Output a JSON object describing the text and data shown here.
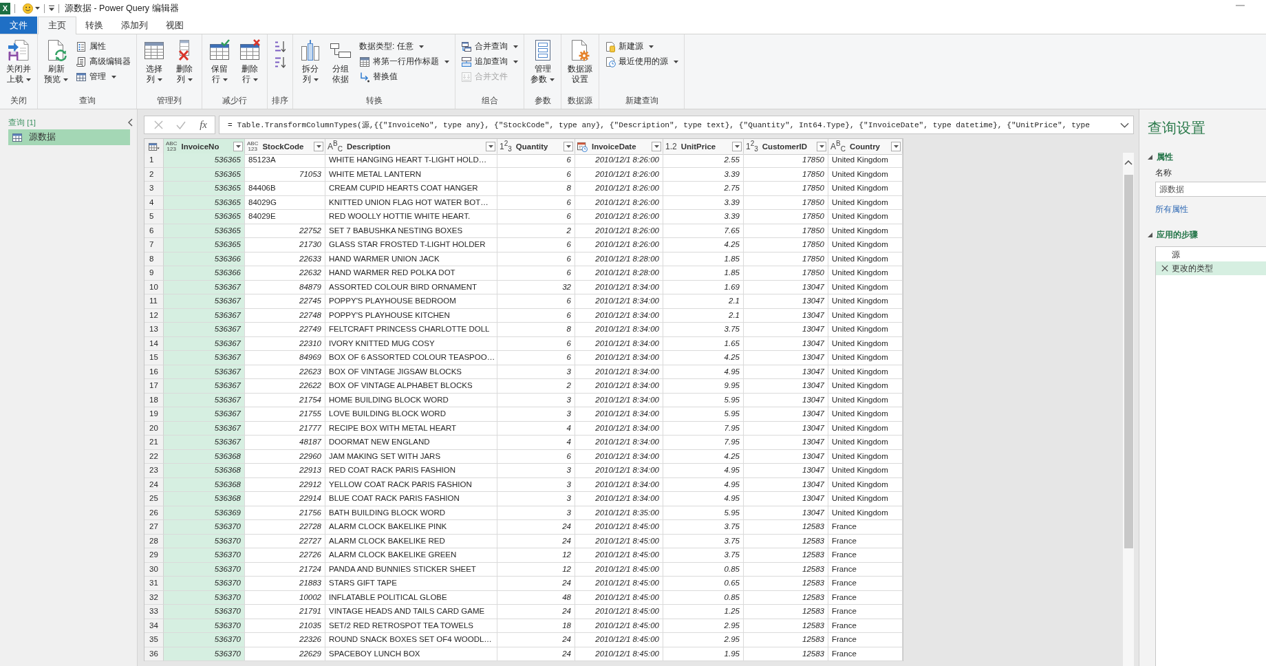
{
  "title_bar": {
    "app_badge": "X",
    "title": "源数据 - Power Query 编辑器"
  },
  "tabs": [
    {
      "label": "文件",
      "kind": "file",
      "selected": false
    },
    {
      "label": "主页",
      "kind": "tab",
      "selected": true
    },
    {
      "label": "转换",
      "kind": "tab",
      "selected": false
    },
    {
      "label": "添加列",
      "kind": "tab",
      "selected": false
    },
    {
      "label": "视图",
      "kind": "tab",
      "selected": false
    }
  ],
  "ribbon": {
    "groups": [
      {
        "label": "关闭",
        "buttons": [
          {
            "kind": "large",
            "lines": [
              "关闭并",
              "上载"
            ],
            "dropdown": true,
            "disabled": false
          }
        ]
      },
      {
        "label": "查询",
        "buttons": [
          {
            "kind": "large",
            "lines": [
              "刷新",
              "预览"
            ],
            "dropdown": true,
            "disabled": false
          },
          {
            "kind": "small",
            "lines": [
              "属性"
            ],
            "dropdown": false,
            "disabled": false
          },
          {
            "kind": "small",
            "lines": [
              "高级编辑器"
            ],
            "dropdown": false,
            "disabled": false
          },
          {
            "kind": "small",
            "lines": [
              "管理"
            ],
            "dropdown": true,
            "disabled": false
          }
        ]
      },
      {
        "label": "管理列",
        "buttons": [
          {
            "kind": "large",
            "lines": [
              "选择",
              "列"
            ],
            "dropdown": true,
            "disabled": false
          },
          {
            "kind": "large",
            "lines": [
              "删除",
              "列"
            ],
            "dropdown": true,
            "disabled": false
          }
        ]
      },
      {
        "label": "减少行",
        "buttons": [
          {
            "kind": "large",
            "lines": [
              "保留",
              "行"
            ],
            "dropdown": true,
            "disabled": false
          },
          {
            "kind": "large",
            "lines": [
              "删除",
              "行"
            ],
            "dropdown": true,
            "disabled": false
          }
        ]
      },
      {
        "label": "排序",
        "buttons": [
          {
            "kind": "icon",
            "dropdown": false,
            "disabled": false
          },
          {
            "kind": "icon",
            "dropdown": false,
            "disabled": false
          }
        ]
      },
      {
        "label": "转换",
        "buttons": [
          {
            "kind": "large",
            "lines": [
              "拆分",
              "列"
            ],
            "dropdown": true,
            "disabled": false
          },
          {
            "kind": "large",
            "lines": [
              "分组",
              "依据"
            ],
            "dropdown": false,
            "disabled": false
          },
          {
            "kind": "small",
            "lines": [
              "数据类型: 任意"
            ],
            "dropdown": true,
            "disabled": false
          },
          {
            "kind": "small",
            "lines": [
              "将第一行用作标题"
            ],
            "dropdown": true,
            "disabled": false
          },
          {
            "kind": "small",
            "lines": [
              "替换值"
            ],
            "dropdown": false,
            "disabled": false
          }
        ]
      },
      {
        "label": "组合",
        "buttons": [
          {
            "kind": "small",
            "lines": [
              "合并查询"
            ],
            "dropdown": true,
            "disabled": false
          },
          {
            "kind": "small",
            "lines": [
              "追加查询"
            ],
            "dropdown": true,
            "disabled": false
          },
          {
            "kind": "small",
            "lines": [
              "合并文件"
            ],
            "dropdown": false,
            "disabled": true
          }
        ]
      },
      {
        "label": "参数",
        "buttons": [
          {
            "kind": "large",
            "lines": [
              "管理",
              "参数"
            ],
            "dropdown": true,
            "disabled": false
          }
        ]
      },
      {
        "label": "数据源",
        "buttons": [
          {
            "kind": "large",
            "lines": [
              "数据源",
              "设置"
            ],
            "dropdown": false,
            "disabled": false
          }
        ]
      },
      {
        "label": "新建查询",
        "buttons": [
          {
            "kind": "small",
            "lines": [
              "新建源"
            ],
            "dropdown": true,
            "disabled": false
          },
          {
            "kind": "small",
            "lines": [
              "最近使用的源"
            ],
            "dropdown": true,
            "disabled": false
          }
        ]
      }
    ]
  },
  "queries_panel": {
    "header": "查询 [1]",
    "items": [
      {
        "label": "源数据",
        "selected": true
      }
    ]
  },
  "formula_bar": {
    "function_label": "fx",
    "formula": "= Table.TransformColumnTypes(源,{{\"InvoiceNo\", type any}, {\"StockCode\", type any}, {\"Description\", type text}, {\"Quantity\", Int64.Type}, {\"InvoiceDate\", type datetime}, {\"UnitPrice\", type"
  },
  "table": {
    "columns": [
      {
        "name": "InvoiceNo",
        "kind": "any",
        "type_label": [
          "ABC",
          "123"
        ],
        "selected": true
      },
      {
        "name": "StockCode",
        "kind": "any",
        "type_label": [
          "ABC",
          "123"
        ],
        "selected": false
      },
      {
        "name": "Description",
        "kind": "text",
        "type_label": [
          "A$^{B}$$_{C}$"
        ],
        "selected": false
      },
      {
        "name": "Quantity",
        "kind": "whole",
        "type_label": [
          "1$^{2}$$_{3}$"
        ],
        "selected": false
      },
      {
        "name": "InvoiceDate",
        "kind": "datetime",
        "selected": false
      },
      {
        "name": "UnitPrice",
        "kind": "decimal",
        "type_label": [
          "1.2"
        ],
        "selected": false
      },
      {
        "name": "CustomerID",
        "kind": "whole",
        "type_label": [
          "1$^{2}$$_{3}$"
        ],
        "selected": false
      },
      {
        "name": "Country",
        "kind": "text",
        "type_label": [
          "A$^{B}$$_{C}$"
        ],
        "selected": false
      }
    ],
    "rows": [
      {
        "number": "1",
        "stock_code_is_text": true,
        "cells": [
          "536365",
          "85123A",
          "WHITE HANGING HEART T-LIGHT HOLD…",
          "6",
          "2010/12/1 8:26:00",
          "2.55",
          "17850",
          "United Kingdom"
        ]
      },
      {
        "number": "2",
        "stock_code_is_text": false,
        "cells": [
          "536365",
          "71053",
          "WHITE METAL LANTERN",
          "6",
          "2010/12/1 8:26:00",
          "3.39",
          "17850",
          "United Kingdom"
        ]
      },
      {
        "number": "3",
        "stock_code_is_text": true,
        "cells": [
          "536365",
          "84406B",
          "CREAM CUPID HEARTS COAT HANGER",
          "8",
          "2010/12/1 8:26:00",
          "2.75",
          "17850",
          "United Kingdom"
        ]
      },
      {
        "number": "4",
        "stock_code_is_text": true,
        "cells": [
          "536365",
          "84029G",
          "KNITTED UNION FLAG HOT WATER BOT…",
          "6",
          "2010/12/1 8:26:00",
          "3.39",
          "17850",
          "United Kingdom"
        ]
      },
      {
        "number": "5",
        "stock_code_is_text": true,
        "cells": [
          "536365",
          "84029E",
          "RED WOOLLY HOTTIE WHITE HEART.",
          "6",
          "2010/12/1 8:26:00",
          "3.39",
          "17850",
          "United Kingdom"
        ]
      },
      {
        "number": "6",
        "stock_code_is_text": false,
        "cells": [
          "536365",
          "22752",
          "SET 7 BABUSHKA NESTING BOXES",
          "2",
          "2010/12/1 8:26:00",
          "7.65",
          "17850",
          "United Kingdom"
        ]
      },
      {
        "number": "7",
        "stock_code_is_text": false,
        "cells": [
          "536365",
          "21730",
          "GLASS STAR FROSTED T-LIGHT HOLDER",
          "6",
          "2010/12/1 8:26:00",
          "4.25",
          "17850",
          "United Kingdom"
        ]
      },
      {
        "number": "8",
        "stock_code_is_text": false,
        "cells": [
          "536366",
          "22633",
          "HAND WARMER UNION JACK",
          "6",
          "2010/12/1 8:28:00",
          "1.85",
          "17850",
          "United Kingdom"
        ]
      },
      {
        "number": "9",
        "stock_code_is_text": false,
        "cells": [
          "536366",
          "22632",
          "HAND WARMER RED POLKA DOT",
          "6",
          "2010/12/1 8:28:00",
          "1.85",
          "17850",
          "United Kingdom"
        ]
      },
      {
        "number": "10",
        "stock_code_is_text": false,
        "cells": [
          "536367",
          "84879",
          "ASSORTED COLOUR BIRD ORNAMENT",
          "32",
          "2010/12/1 8:34:00",
          "1.69",
          "13047",
          "United Kingdom"
        ]
      },
      {
        "number": "11",
        "stock_code_is_text": false,
        "cells": [
          "536367",
          "22745",
          "POPPY'S PLAYHOUSE BEDROOM",
          "6",
          "2010/12/1 8:34:00",
          "2.1",
          "13047",
          "United Kingdom"
        ]
      },
      {
        "number": "12",
        "stock_code_is_text": false,
        "cells": [
          "536367",
          "22748",
          "POPPY'S PLAYHOUSE KITCHEN",
          "6",
          "2010/12/1 8:34:00",
          "2.1",
          "13047",
          "United Kingdom"
        ]
      },
      {
        "number": "13",
        "stock_code_is_text": false,
        "cells": [
          "536367",
          "22749",
          "FELTCRAFT PRINCESS CHARLOTTE DOLL",
          "8",
          "2010/12/1 8:34:00",
          "3.75",
          "13047",
          "United Kingdom"
        ]
      },
      {
        "number": "14",
        "stock_code_is_text": false,
        "cells": [
          "536367",
          "22310",
          "IVORY KNITTED MUG COSY",
          "6",
          "2010/12/1 8:34:00",
          "1.65",
          "13047",
          "United Kingdom"
        ]
      },
      {
        "number": "15",
        "stock_code_is_text": false,
        "cells": [
          "536367",
          "84969",
          "BOX OF 6 ASSORTED COLOUR TEASPOO…",
          "6",
          "2010/12/1 8:34:00",
          "4.25",
          "13047",
          "United Kingdom"
        ]
      },
      {
        "number": "16",
        "stock_code_is_text": false,
        "cells": [
          "536367",
          "22623",
          "BOX OF VINTAGE JIGSAW BLOCKS",
          "3",
          "2010/12/1 8:34:00",
          "4.95",
          "13047",
          "United Kingdom"
        ]
      },
      {
        "number": "17",
        "stock_code_is_text": false,
        "cells": [
          "536367",
          "22622",
          "BOX OF VINTAGE ALPHABET BLOCKS",
          "2",
          "2010/12/1 8:34:00",
          "9.95",
          "13047",
          "United Kingdom"
        ]
      },
      {
        "number": "18",
        "stock_code_is_text": false,
        "cells": [
          "536367",
          "21754",
          "HOME BUILDING BLOCK WORD",
          "3",
          "2010/12/1 8:34:00",
          "5.95",
          "13047",
          "United Kingdom"
        ]
      },
      {
        "number": "19",
        "stock_code_is_text": false,
        "cells": [
          "536367",
          "21755",
          "LOVE BUILDING BLOCK WORD",
          "3",
          "2010/12/1 8:34:00",
          "5.95",
          "13047",
          "United Kingdom"
        ]
      },
      {
        "number": "20",
        "stock_code_is_text": false,
        "cells": [
          "536367",
          "21777",
          "RECIPE BOX WITH METAL HEART",
          "4",
          "2010/12/1 8:34:00",
          "7.95",
          "13047",
          "United Kingdom"
        ]
      },
      {
        "number": "21",
        "stock_code_is_text": false,
        "cells": [
          "536367",
          "48187",
          "DOORMAT NEW ENGLAND",
          "4",
          "2010/12/1 8:34:00",
          "7.95",
          "13047",
          "United Kingdom"
        ]
      },
      {
        "number": "22",
        "stock_code_is_text": false,
        "cells": [
          "536368",
          "22960",
          "JAM MAKING SET WITH JARS",
          "6",
          "2010/12/1 8:34:00",
          "4.25",
          "13047",
          "United Kingdom"
        ]
      },
      {
        "number": "23",
        "stock_code_is_text": false,
        "cells": [
          "536368",
          "22913",
          "RED COAT RACK PARIS FASHION",
          "3",
          "2010/12/1 8:34:00",
          "4.95",
          "13047",
          "United Kingdom"
        ]
      },
      {
        "number": "24",
        "stock_code_is_text": false,
        "cells": [
          "536368",
          "22912",
          "YELLOW COAT RACK PARIS FASHION",
          "3",
          "2010/12/1 8:34:00",
          "4.95",
          "13047",
          "United Kingdom"
        ]
      },
      {
        "number": "25",
        "stock_code_is_text": false,
        "cells": [
          "536368",
          "22914",
          "BLUE COAT RACK PARIS FASHION",
          "3",
          "2010/12/1 8:34:00",
          "4.95",
          "13047",
          "United Kingdom"
        ]
      },
      {
        "number": "26",
        "stock_code_is_text": false,
        "cells": [
          "536369",
          "21756",
          "BATH BUILDING BLOCK WORD",
          "3",
          "2010/12/1 8:35:00",
          "5.95",
          "13047",
          "United Kingdom"
        ]
      },
      {
        "number": "27",
        "stock_code_is_text": false,
        "cells": [
          "536370",
          "22728",
          "ALARM CLOCK BAKELIKE PINK",
          "24",
          "2010/12/1 8:45:00",
          "3.75",
          "12583",
          "France"
        ]
      },
      {
        "number": "28",
        "stock_code_is_text": false,
        "cells": [
          "536370",
          "22727",
          "ALARM CLOCK BAKELIKE RED",
          "24",
          "2010/12/1 8:45:00",
          "3.75",
          "12583",
          "France"
        ]
      },
      {
        "number": "29",
        "stock_code_is_text": false,
        "cells": [
          "536370",
          "22726",
          "ALARM CLOCK BAKELIKE GREEN",
          "12",
          "2010/12/1 8:45:00",
          "3.75",
          "12583",
          "France"
        ]
      },
      {
        "number": "30",
        "stock_code_is_text": false,
        "cells": [
          "536370",
          "21724",
          "PANDA AND BUNNIES STICKER SHEET",
          "12",
          "2010/12/1 8:45:00",
          "0.85",
          "12583",
          "France"
        ]
      },
      {
        "number": "31",
        "stock_code_is_text": false,
        "cells": [
          "536370",
          "21883",
          "STARS GIFT TAPE",
          "24",
          "2010/12/1 8:45:00",
          "0.65",
          "12583",
          "France"
        ]
      },
      {
        "number": "32",
        "stock_code_is_text": false,
        "cells": [
          "536370",
          "10002",
          "INFLATABLE POLITICAL GLOBE",
          "48",
          "2010/12/1 8:45:00",
          "0.85",
          "12583",
          "France"
        ]
      },
      {
        "number": "33",
        "stock_code_is_text": false,
        "cells": [
          "536370",
          "21791",
          "VINTAGE HEADS AND TAILS CARD GAME",
          "24",
          "2010/12/1 8:45:00",
          "1.25",
          "12583",
          "France"
        ]
      },
      {
        "number": "34",
        "stock_code_is_text": false,
        "cells": [
          "536370",
          "21035",
          "SET/2 RED RETROSPOT TEA TOWELS",
          "18",
          "2010/12/1 8:45:00",
          "2.95",
          "12583",
          "France"
        ]
      },
      {
        "number": "35",
        "stock_code_is_text": false,
        "cells": [
          "536370",
          "22326",
          "ROUND SNACK BOXES SET OF4 WOODL…",
          "24",
          "2010/12/1 8:45:00",
          "2.95",
          "12583",
          "France"
        ]
      },
      {
        "number": "36",
        "stock_code_is_text": false,
        "cells": [
          "536370",
          "22629",
          "SPACEBOY LUNCH BOX",
          "24",
          "2010/12/1 8:45:00",
          "1.95",
          "12583",
          "France"
        ]
      }
    ]
  },
  "query_settings": {
    "title": "查询设置",
    "properties": {
      "heading": "属性",
      "expanded": true,
      "name_label": "名称",
      "name_value": "源数据",
      "link": "所有属性"
    },
    "applied_steps": {
      "heading": "应用的步骤",
      "expanded": true,
      "steps": [
        {
          "label": "源",
          "selected": false
        },
        {
          "label": "更改的类型",
          "selected": true
        }
      ]
    }
  }
}
